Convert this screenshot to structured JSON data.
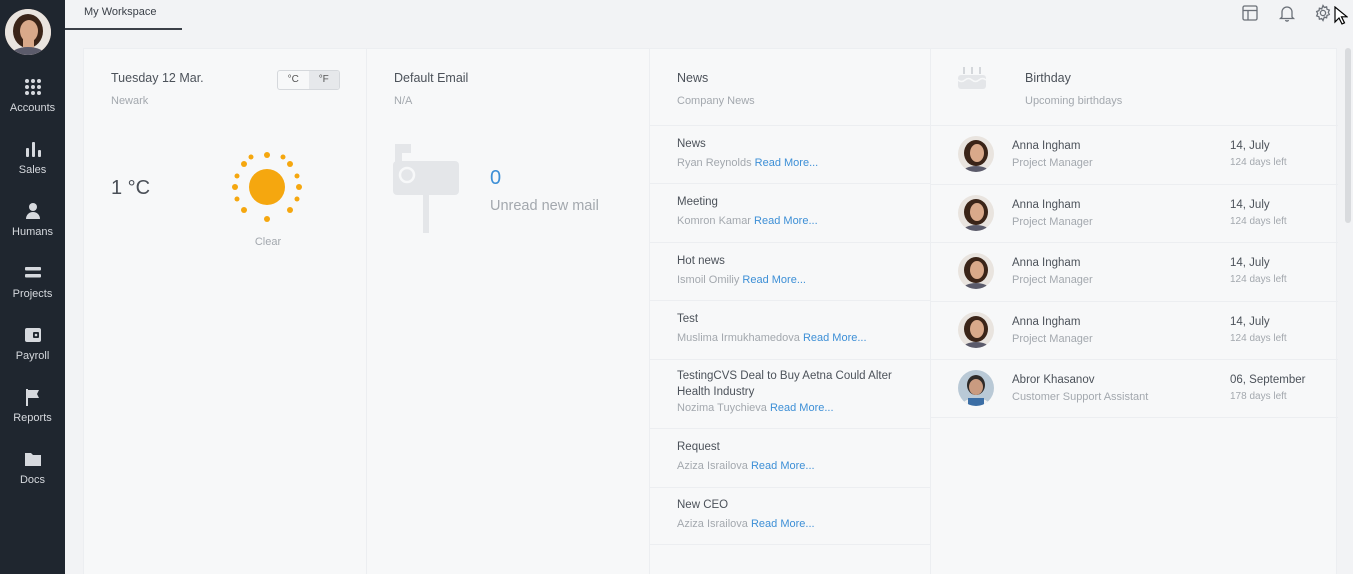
{
  "sidebar": {
    "items": [
      {
        "label": "Accounts",
        "icon": "grid-icon"
      },
      {
        "label": "Sales",
        "icon": "bar-chart-icon"
      },
      {
        "label": "Humans",
        "icon": "person-icon"
      },
      {
        "label": "Projects",
        "icon": "stack-icon"
      },
      {
        "label": "Payroll",
        "icon": "wallet-icon"
      },
      {
        "label": "Reports",
        "icon": "flag-icon"
      },
      {
        "label": "Docs",
        "icon": "folder-icon"
      }
    ]
  },
  "topbar": {
    "tab_label": "My Workspace",
    "icons": [
      "layout-icon",
      "bell-icon",
      "gear-icon"
    ]
  },
  "weather": {
    "date": "Tuesday 12 Mar.",
    "city": "Newark",
    "unit_c": "°C",
    "unit_f": "°F",
    "temperature": "1 °C",
    "condition": "Clear"
  },
  "email": {
    "title": "Default Email",
    "subtitle": "N/A",
    "count": "0",
    "count_label": "Unread new mail"
  },
  "news": {
    "title": "News",
    "subtitle": "Company News",
    "read_more": "Read More...",
    "items": [
      {
        "title": "News",
        "author": "Ryan Reynolds"
      },
      {
        "title": "Meeting",
        "author": "Komron Kamar"
      },
      {
        "title": "Hot news",
        "author": "Ismoil Omiliy"
      },
      {
        "title": "Test",
        "author": "Muslima Irmukhamedova"
      },
      {
        "title": "TestingCVS Deal to Buy Aetna Could Alter Health Industry",
        "author": "Nozima Tuychieva"
      },
      {
        "title": "Request",
        "author": "Aziza Israilova"
      },
      {
        "title": "New CEO",
        "author": "Aziza Israilova"
      }
    ]
  },
  "birthday": {
    "title": "Birthday",
    "subtitle": "Upcoming birthdays",
    "people": [
      {
        "name": "Anna Ingham",
        "role": "Project Manager",
        "date": "14, July",
        "left": "124 days left"
      },
      {
        "name": "Anna Ingham",
        "role": "Project Manager",
        "date": "14, July",
        "left": "124 days left"
      },
      {
        "name": "Anna Ingham",
        "role": "Project Manager",
        "date": "14, July",
        "left": "124 days left"
      },
      {
        "name": "Anna Ingham",
        "role": "Project Manager",
        "date": "14, July",
        "left": "124 days left"
      },
      {
        "name": "Abror Khasanov",
        "role": "Customer Support Assistant",
        "date": "06, September",
        "left": "178 days left"
      }
    ]
  },
  "colors": {
    "sidebar_bg": "#1f262f",
    "accent_link": "#3d8fd6",
    "sun": "#f5a70f"
  }
}
